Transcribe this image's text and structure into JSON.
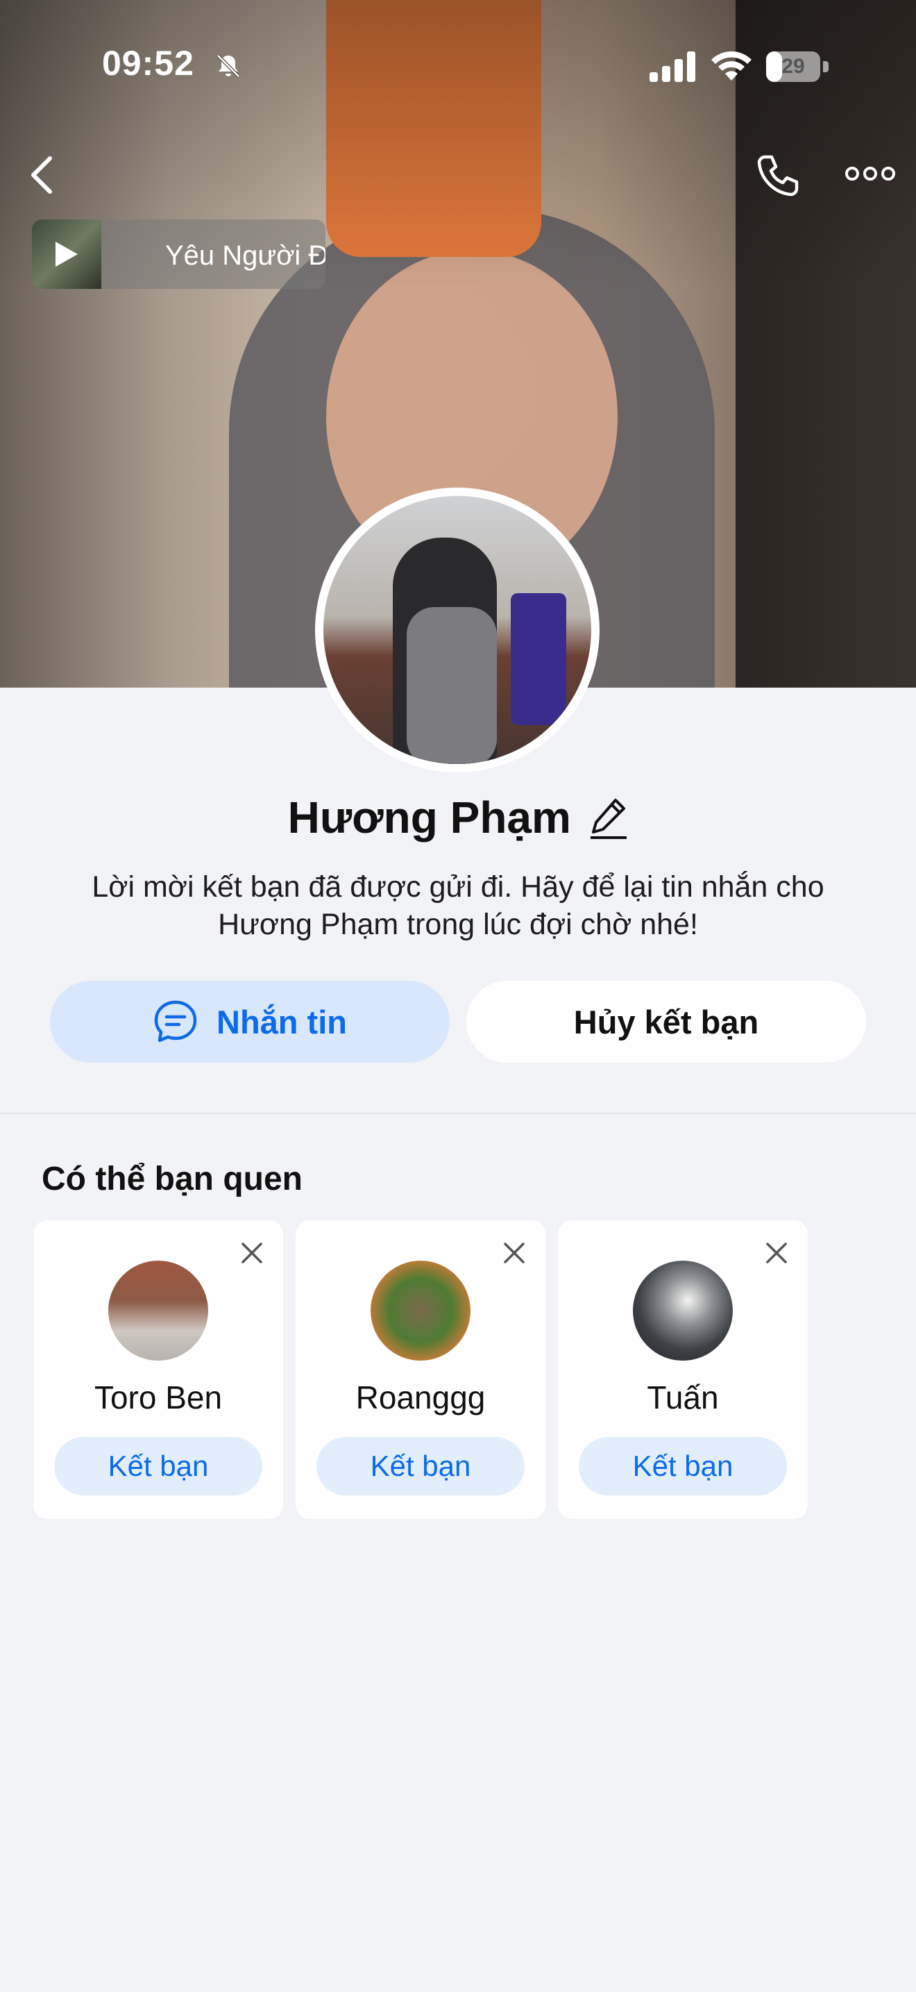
{
  "status_bar": {
    "time": "09:52",
    "battery": "29",
    "battery_level": 0.29
  },
  "header": {
    "music_title": "Yêu Người Đ"
  },
  "profile": {
    "name": "Hương Phạm",
    "description": "Lời mời kết bạn đã được gửi đi. Hãy để lại tin nhắn cho Hương Phạm trong lúc đợi chờ nhé!",
    "message_button": "Nhắn tin",
    "cancel_button": "Hủy kết bạn"
  },
  "suggestions": {
    "title": "Có thể bạn quen",
    "items": [
      {
        "name": "Toro Ben",
        "button": "Kết bạn"
      },
      {
        "name": "Roanggg",
        "button": "Kết bạn"
      },
      {
        "name": "Tuấn",
        "button": "Kết bạn"
      }
    ]
  },
  "colors": {
    "accent": "#0b6be8",
    "accent_soft": "#d9e7fd",
    "background": "#f2f3f6"
  },
  "icons": [
    "back-icon",
    "phone-icon",
    "more-icon",
    "play-icon",
    "edit-icon",
    "chat-icon",
    "close-icon",
    "bell-slash-icon",
    "signal-icon",
    "wifi-icon",
    "battery-icon"
  ]
}
